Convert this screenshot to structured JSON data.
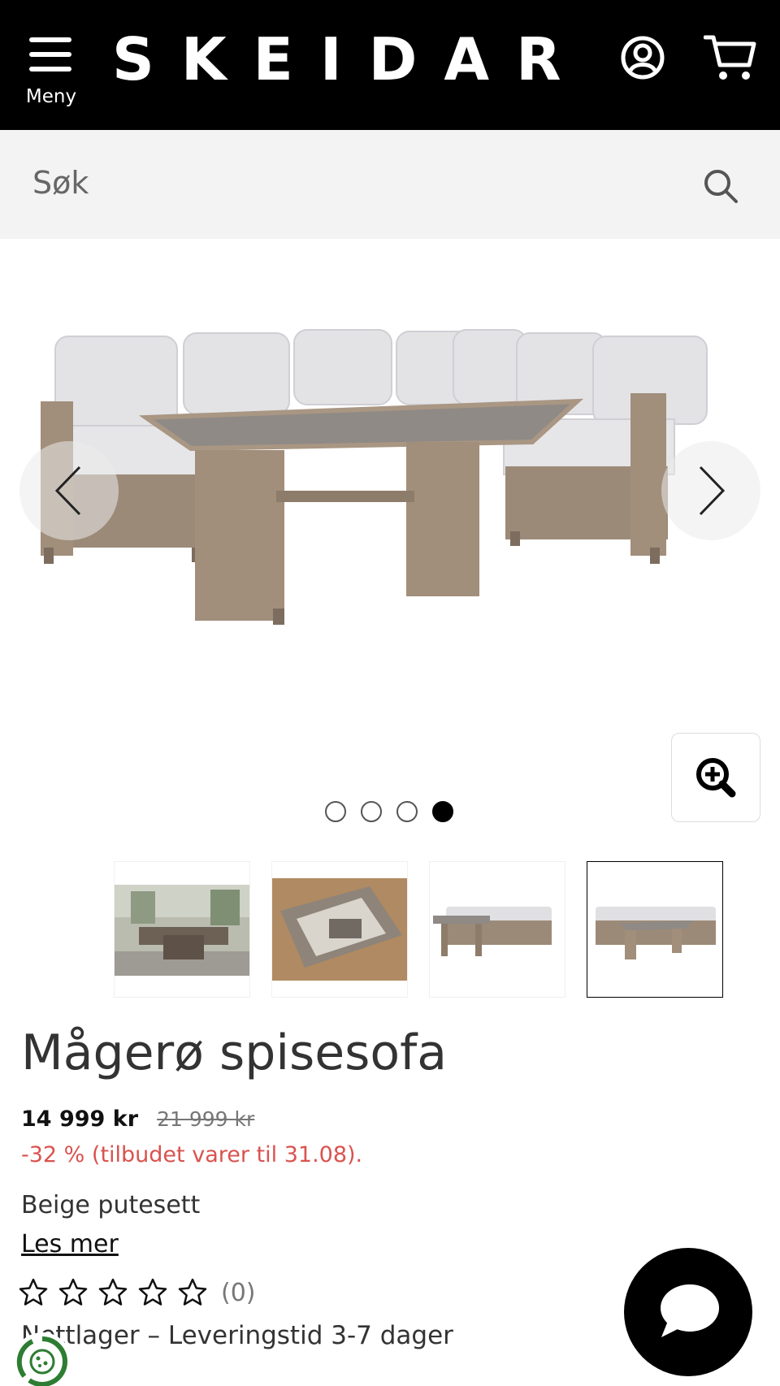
{
  "header": {
    "menu_label": "Meny",
    "logo_text": "SKEIDAR",
    "icons": [
      "menu-icon",
      "account-icon",
      "cart-icon"
    ]
  },
  "search": {
    "placeholder": "Søk",
    "icon": "search-icon"
  },
  "gallery": {
    "image_count": 4,
    "active_index": 4,
    "icons": [
      "chevron-left-icon",
      "chevron-right-icon",
      "zoom-in-icon"
    ]
  },
  "product": {
    "title": "Mågerø spisesofa",
    "price_now": "14 999 kr",
    "price_old": "21 999 kr",
    "discount_text": "-32 % (tilbudet varer til 31.08).",
    "variant": "Beige putesett",
    "read_more": "Les mer",
    "rating_stars": 0,
    "rating_max": 5,
    "rating_count": "(0)",
    "stock_text": "Nettlager – Leveringstid 3-7 dager"
  },
  "colors": {
    "header_bg": "#000000",
    "search_bg": "#f3f3f3",
    "discount": "#d9534f",
    "wicker": "#9c8a78",
    "cushion": "#e2e2e4",
    "cookie_green": "#2e7d32"
  }
}
